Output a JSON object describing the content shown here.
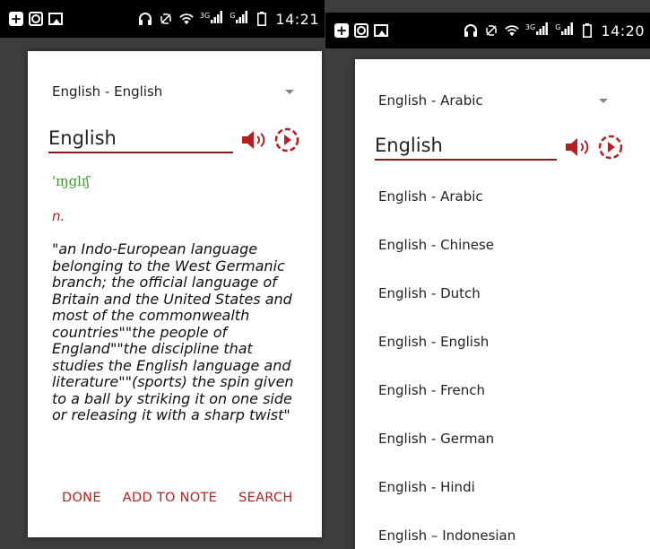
{
  "left": {
    "status": {
      "time": "14:21",
      "net1": "3G",
      "net2": "G"
    },
    "dictionary_label": "English - English",
    "word": "English",
    "phonetic": "'ɪŋglɪʃ",
    "part_of_speech": "n.",
    "definition": "\"an Indo-European language belonging to the West Germanic branch; the official language of Britain and the United States and most of the commonwealth countries\"\"the people of England\"\"the discipline that studies the English language and literature\"\"(sports) the spin given to a ball by striking it on one side or releasing it with a sharp twist\"",
    "actions": {
      "done": "DONE",
      "add_to_note": "ADD TO NOTE",
      "search": "SEARCH"
    }
  },
  "right": {
    "status": {
      "time": "14:20",
      "net1": "3G",
      "net2": "G"
    },
    "dictionary_label": "English - Arabic",
    "word": "English",
    "options": [
      "English - Arabic",
      "English - Chinese",
      "English - Dutch",
      "English - English",
      "English - French",
      "English - German",
      "English - Hindi",
      "English – Indonesian"
    ]
  },
  "colors": {
    "accent": "#8b1a1a",
    "action": "#b22222",
    "phonetic": "#3a9b2a"
  }
}
